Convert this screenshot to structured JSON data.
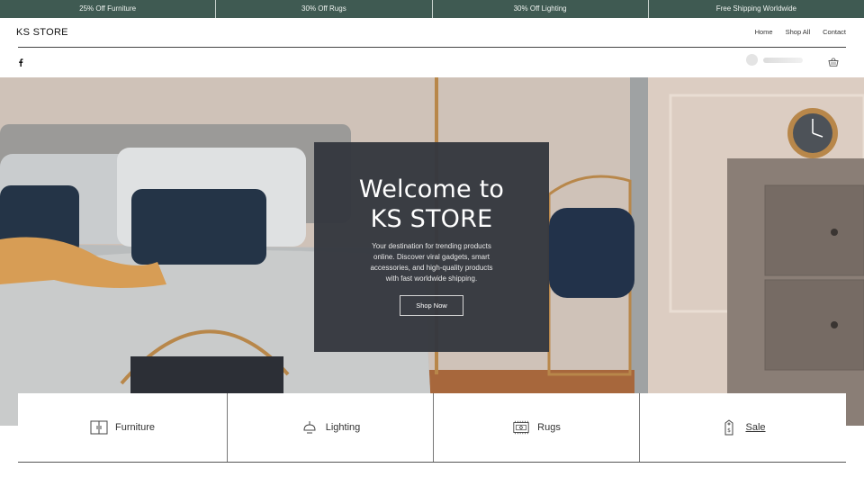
{
  "promo_bar": {
    "items": [
      "25% Off Furniture",
      "30% Off Rugs",
      "30% Off Lighting",
      "Free Shipping Worldwide"
    ]
  },
  "header": {
    "logo": "KS STORE",
    "nav": [
      "Home",
      "Shop All",
      "Contact"
    ],
    "social_icon": "facebook-icon",
    "cart_icon": "basket-icon"
  },
  "hero": {
    "title": "Welcome to KS STORE",
    "description": "Your destination for trending products online. Discover viral gadgets, smart accessories, and high-quality products with fast worldwide shipping.",
    "cta_label": "Shop Now"
  },
  "categories": [
    {
      "label": "Furniture",
      "icon": "cabinet-icon"
    },
    {
      "label": "Lighting",
      "icon": "lamp-icon"
    },
    {
      "label": "Rugs",
      "icon": "rug-icon"
    },
    {
      "label": "Sale",
      "icon": "tag-icon"
    }
  ],
  "colors": {
    "promo_bar": "#3f5a52",
    "hero_panel": "#34373e"
  }
}
